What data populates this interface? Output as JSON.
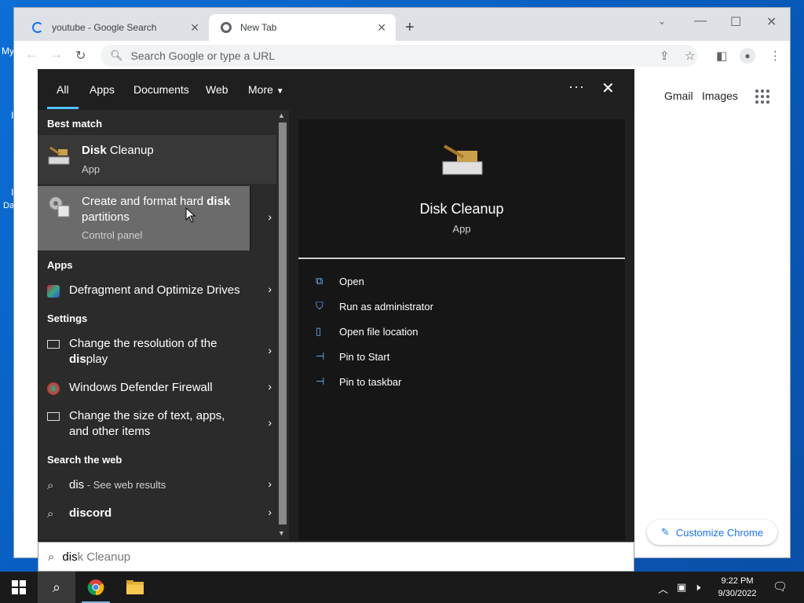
{
  "desktop": {
    "labels": [
      "My",
      "Da"
    ]
  },
  "browser": {
    "tabs": [
      {
        "label": "youtube - Google Search",
        "loading": true
      },
      {
        "label": "New Tab",
        "active": true
      }
    ],
    "omnibox_placeholder": "Search Google or type a URL",
    "ntp": {
      "gmail": "Gmail",
      "images": "Images",
      "customize": "Customize Chrome"
    }
  },
  "search": {
    "tabs": [
      "All",
      "Apps",
      "Documents",
      "Web",
      "More"
    ],
    "best_match": {
      "heading": "Best match",
      "title_bold": "Disk",
      "title_rest": " Cleanup",
      "type": "App"
    },
    "hovered": {
      "title_pre": "Create and format hard ",
      "title_bold": "disk",
      "title_line2": "partitions",
      "type": "Control panel"
    },
    "apps": {
      "heading": "Apps",
      "items": [
        {
          "pre": "Defragment and Optimize Drives"
        }
      ]
    },
    "settings": {
      "heading": "Settings",
      "items": [
        {
          "line1": "Change the resolution of the",
          "line2_bold": "dis",
          "line2_rest": "play"
        },
        {
          "line1": "Windows Defender Firewall"
        },
        {
          "line1": "Change the size of text, apps,",
          "line2": "and other items"
        }
      ]
    },
    "web": {
      "heading": "Search the web",
      "items": [
        {
          "bold": "dis",
          "rest": " - See web results"
        },
        {
          "bold": "discord"
        }
      ]
    },
    "detail": {
      "title": "Disk Cleanup",
      "type": "App",
      "actions": [
        "Open",
        "Run as administrator",
        "Open file location",
        "Pin to Start",
        "Pin to taskbar"
      ]
    },
    "query_typed": "dis",
    "query_hint": "k Cleanup"
  },
  "taskbar": {
    "time": "9:22 PM",
    "date": "9/30/2022"
  }
}
